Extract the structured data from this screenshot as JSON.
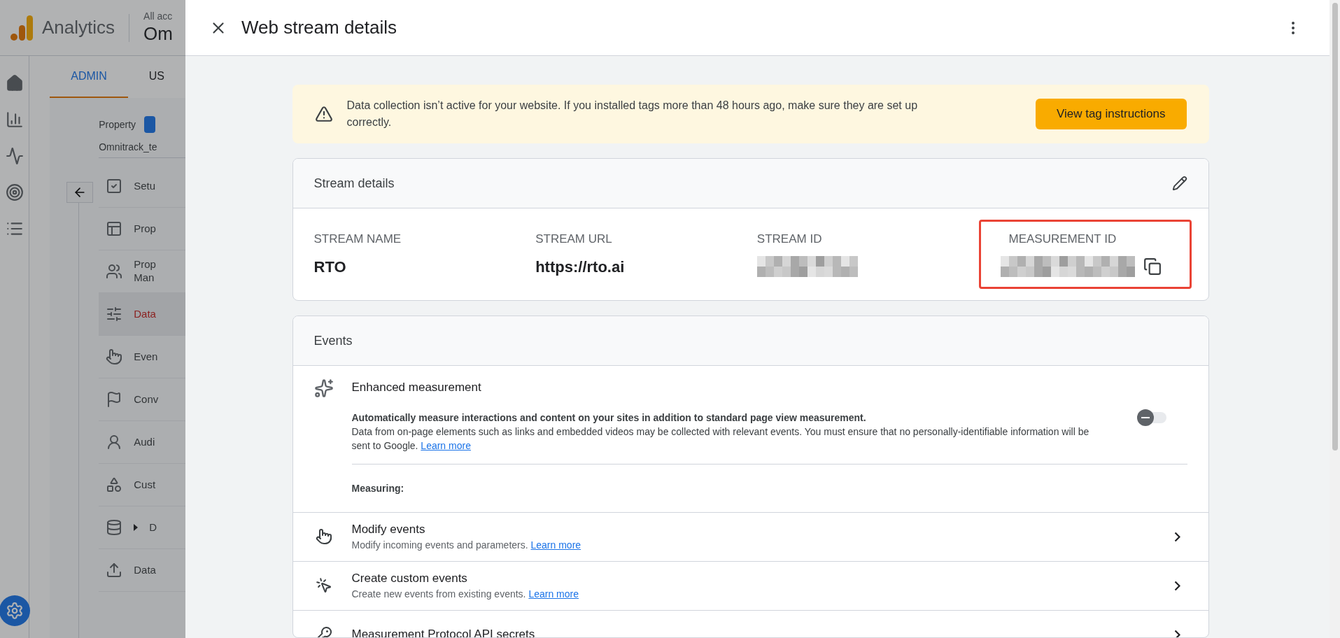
{
  "background_app": {
    "product": "Analytics",
    "account_label": "All acc",
    "account_name": "Om",
    "tabs": [
      {
        "label": "ADMIN",
        "selected": true
      },
      {
        "label": "US",
        "selected": false
      }
    ],
    "property_label": "Property",
    "property_name": "Omnitrack_te",
    "nav_items": [
      {
        "label": "Setu",
        "selected": false
      },
      {
        "label": "Prop",
        "selected": false
      },
      {
        "label": "Prop\nMan",
        "selected": false
      },
      {
        "label": "Data",
        "selected": true
      },
      {
        "label": "Even",
        "selected": false
      },
      {
        "label": "Conv",
        "selected": false
      },
      {
        "label": "Audi",
        "selected": false
      },
      {
        "label": "Cust",
        "selected": false
      },
      {
        "label": "D",
        "selected": false
      },
      {
        "label": "Data",
        "selected": false
      }
    ]
  },
  "panel": {
    "title": "Web stream details",
    "banner": {
      "text": "Data collection isn’t active for your website. If you installed tags more than 48 hours ago, make sure they are set up correctly.",
      "button": "View tag instructions"
    },
    "stream_details": {
      "title": "Stream details",
      "fields": [
        {
          "kind": "text",
          "label": "STREAM NAME",
          "value": "RTO"
        },
        {
          "kind": "text",
          "label": "STREAM URL",
          "value": "https://rto.ai"
        },
        {
          "kind": "redacted",
          "label": "STREAM ID"
        },
        {
          "kind": "redacted_copy",
          "label": "MEASUREMENT ID",
          "highlighted": true
        }
      ]
    },
    "events": {
      "title": "Events",
      "enhanced": {
        "title": "Enhanced measurement",
        "on": false,
        "lead": "Automatically measure interactions and content on your sites in addition to standard page view measurement.",
        "body": "Data from on-page elements such as links and embedded videos may be collected with relevant events. You must ensure that no personally-identifiable information will be sent to Google.",
        "link": "Learn more",
        "measuring_label": "Measuring:"
      },
      "rows": [
        {
          "title": "Modify events",
          "subtitle": "Modify incoming events and parameters.",
          "link": "Learn more"
        },
        {
          "title": "Create custom events",
          "subtitle": "Create new events from existing events.",
          "link": "Learn more"
        },
        {
          "title": "Measurement Protocol API secrets"
        }
      ]
    }
  }
}
